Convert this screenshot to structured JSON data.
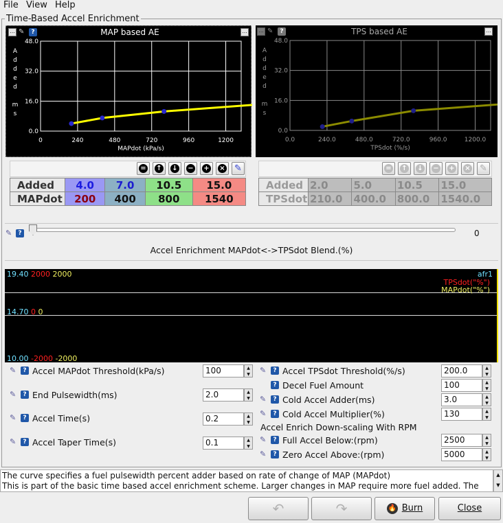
{
  "menu": {
    "items": [
      "File",
      "View",
      "Help"
    ]
  },
  "window_title": "Time-Based Accel Enrichment",
  "charts": {
    "map": {
      "title": "MAP based AE",
      "ylabel_letters": [
        "A",
        "d",
        "d",
        "e",
        "d",
        "",
        "m",
        "s"
      ],
      "xlabel": "MAPdot (kPa/s)",
      "yticks": [
        "48.0",
        "32.0",
        "16.0",
        "0.0"
      ],
      "xticks": [
        "0",
        "240",
        "480",
        "720",
        "960",
        "1200"
      ]
    },
    "tps": {
      "title": "TPS based AE",
      "ylabel_letters": [
        "A",
        "d",
        "d",
        "e",
        "d",
        "",
        "m",
        "s"
      ],
      "xlabel": "TPSdot (%/s)",
      "yticks": [
        "48.0",
        "32.0",
        "16.0",
        "0.0"
      ],
      "xticks": [
        "0.0",
        "240.0",
        "480.0",
        "720.0",
        "960.0",
        "1200.0"
      ]
    }
  },
  "chart_data": [
    {
      "type": "line",
      "title": "MAP based AE",
      "xlabel": "MAPdot (kPa/s)",
      "ylabel": "Added ms",
      "x": [
        200,
        400,
        800,
        1540
      ],
      "y": [
        4.0,
        7.0,
        10.5,
        15.0
      ],
      "xlim": [
        0,
        1300
      ],
      "ylim": [
        0,
        48
      ],
      "color": "#ffff00"
    },
    {
      "type": "line",
      "title": "TPS based AE",
      "xlabel": "TPSdot (%/s)",
      "ylabel": "Added ms",
      "x": [
        210,
        400,
        800,
        1540
      ],
      "y": [
        2.0,
        5.0,
        10.5,
        15.0
      ],
      "xlim": [
        0,
        1300
      ],
      "ylim": [
        0,
        48
      ],
      "color": "#8b8b00"
    }
  ],
  "map_table": {
    "row1_label": "Added",
    "row2_label": "MAPdot",
    "added": [
      "4.0",
      "7.0",
      "10.5",
      "15.0"
    ],
    "mapdot": [
      "200",
      "400",
      "800",
      "1540"
    ]
  },
  "tps_table": {
    "row1_label": "Added",
    "row2_label": "TPSdot",
    "added": [
      "2.0",
      "5.0",
      "10.5",
      "15.0"
    ],
    "tpsdot": [
      "210.0",
      "400.0",
      "800.0",
      "1540.0"
    ]
  },
  "blend": {
    "label": "Accel Enrichment MAPdot<->TPSdot Blend.(%)",
    "value": "0"
  },
  "gauge": {
    "top_afr": "19.40",
    "top_tps": "2000",
    "top_map": "2000",
    "mid_afr": "14.70",
    "mid_tps": "0",
    "mid_map": "0",
    "bot_afr": "10.00",
    "bot_tps": "-2000",
    "bot_map": "-2000",
    "legend_afr": "afr1",
    "legend_tps": "TPSdot(\"%\")",
    "legend_map": "MAPdot(\"%\")"
  },
  "left_settings": [
    {
      "label": "Accel MAPdot Threshold(kPa/s)",
      "value": "100"
    },
    {
      "label": "End Pulsewidth(ms)",
      "value": "2.0"
    },
    {
      "label": "Accel Time(s)",
      "value": "0.2"
    },
    {
      "label": "Accel Taper Time(s)",
      "value": "0.1"
    }
  ],
  "right_settings": [
    {
      "label": "Accel TPSdot Threshold(%/s)",
      "value": "200.0"
    },
    {
      "label": "Decel Fuel Amount",
      "value": "100"
    },
    {
      "label": "Cold Accel Adder(ms)",
      "value": "3.0"
    },
    {
      "label": "Cold Accel Multiplier(%)",
      "value": "130"
    }
  ],
  "rpm_section": {
    "title": "Accel Enrich Down-scaling With RPM",
    "items": [
      {
        "label": "Full Accel Below:(rpm)",
        "value": "2500"
      },
      {
        "label": "Zero Accel Above:(rpm)",
        "value": "5000"
      }
    ]
  },
  "help_text": {
    "line1": "The curve specifies a fuel pulsewidth percent adder based on rate of change of MAP (MAPdot)",
    "line2": "This is part of the basic time based accel enrichment scheme. Larger changes in MAP require more fuel added. The"
  },
  "buttons": {
    "burn": "Burn",
    "close": "Close"
  }
}
